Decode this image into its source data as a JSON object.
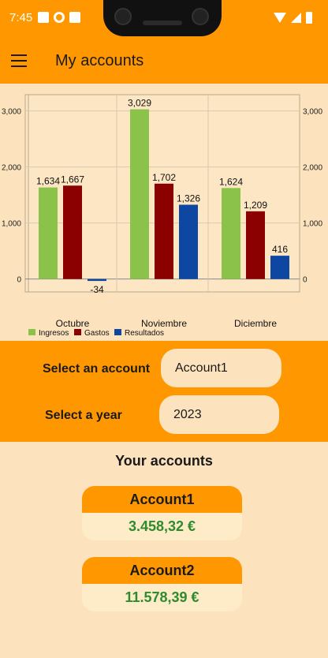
{
  "status_bar": {
    "time": "7:45"
  },
  "app_bar": {
    "title": "My accounts"
  },
  "chart_data": {
    "type": "bar",
    "categories": [
      "Octubre",
      "Noviembre",
      "Diciembre"
    ],
    "series": [
      {
        "name": "Ingresos",
        "color": "#8bc34a",
        "values": [
          1634,
          3029,
          1624
        ],
        "labels": [
          "1,634",
          "3,029",
          "1,624"
        ]
      },
      {
        "name": "Gastos",
        "color": "#8b0000",
        "values": [
          1667,
          1702,
          1209
        ],
        "labels": [
          "1,667",
          "1,702",
          "1,209"
        ]
      },
      {
        "name": "Resultados",
        "color": "#0d47a1",
        "values": [
          -34,
          1326,
          416
        ],
        "labels": [
          "-34",
          "1,326",
          "416"
        ]
      }
    ],
    "yticks": [
      0,
      1000,
      2000,
      3000
    ],
    "ytick_labels": [
      "0",
      "1,000",
      "2,000",
      "3,000"
    ],
    "ylim": [
      -230,
      3290
    ],
    "legend_position": "bottom-left",
    "grid": true,
    "dual_y_axis": true
  },
  "selectors": {
    "account_label": "Select an account",
    "account_value": "Account1",
    "year_label": "Select a year",
    "year_value": "2023"
  },
  "accounts": {
    "title": "Your accounts",
    "items": [
      {
        "name": "Account1",
        "balance": "3.458,32 €"
      },
      {
        "name": "Account2",
        "balance": "11.578,39 €"
      }
    ]
  }
}
